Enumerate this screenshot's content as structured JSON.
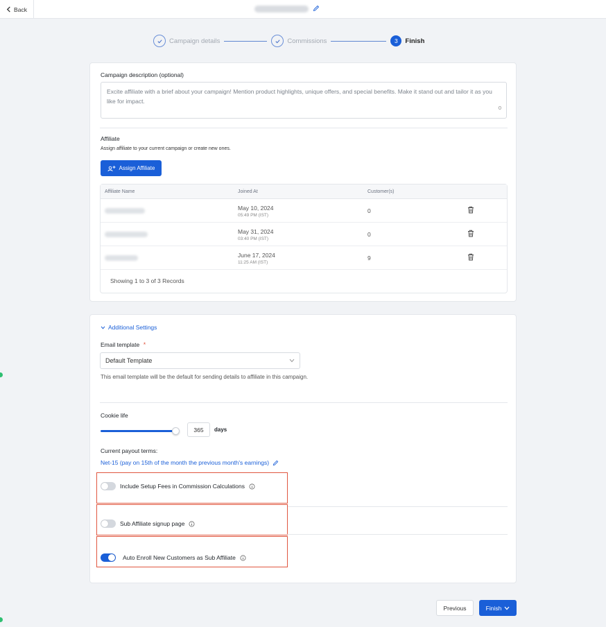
{
  "topbar": {
    "back_label": "Back"
  },
  "stepper": {
    "steps": [
      {
        "label": "Campaign details",
        "state": "done"
      },
      {
        "label": "Commissions",
        "state": "done"
      },
      {
        "number": "3",
        "label": "Finish",
        "state": "active"
      }
    ]
  },
  "description": {
    "label": "Campaign description (optional)",
    "placeholder": "Excite affiliate with a brief about your campaign! Mention product highlights, unique offers, and special benefits. Make it stand out and tailor it as you like for impact.",
    "char_count": "0"
  },
  "affiliate": {
    "title": "Affiliate",
    "subtitle": "Assign affiliate to your current campaign or create new ones.",
    "assign_label": "Assign Affiliate",
    "columns": [
      "Affiliate Name",
      "Joined At",
      "Customer(s)"
    ],
    "rows": [
      {
        "date": "May 10, 2024",
        "time": "05:49 PM (IST)",
        "customers": "0"
      },
      {
        "date": "May 31, 2024",
        "time": "03:40 PM (IST)",
        "customers": "0"
      },
      {
        "date": "June 17, 2024",
        "time": "11:25 AM (IST)",
        "customers": "9"
      }
    ],
    "records_text": "Showing 1 to 3 of 3 Records"
  },
  "settings": {
    "toggle_label": "Additional Settings",
    "email_template_label": "Email template",
    "required_mark": "*",
    "email_template_value": "Default Template",
    "email_template_help": "This email template will be the default for sending details to affiliate in this campaign.",
    "cookie_label": "Cookie life",
    "cookie_value": "365",
    "cookie_unit": "days",
    "payout_label": "Current payout terms:",
    "payout_value": "Net-15 (pay on 15th of the month the previous month's earnings)",
    "toggles": [
      {
        "label": "Include Setup Fees in Commission Calculations",
        "on": false
      },
      {
        "label": "Sub Affiliate signup page",
        "on": false
      },
      {
        "label": "Auto Enroll New Customers as Sub Affiliate",
        "on": true
      }
    ]
  },
  "footer": {
    "previous_label": "Previous",
    "finish_label": "Finish"
  },
  "colors": {
    "accent": "#1a5fd8",
    "highlight_border": "#e0563f"
  }
}
